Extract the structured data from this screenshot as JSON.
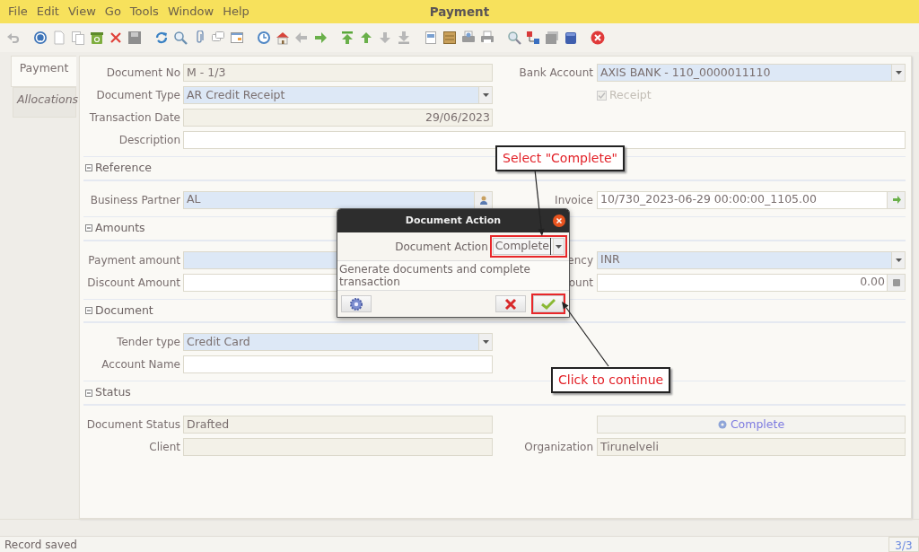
{
  "window": {
    "title": "Payment"
  },
  "menu": [
    {
      "label": "File"
    },
    {
      "label": "Edit"
    },
    {
      "label": "View"
    },
    {
      "label": "Go"
    },
    {
      "label": "Tools"
    },
    {
      "label": "Window"
    },
    {
      "label": "Help"
    }
  ],
  "tabs": [
    {
      "label": "Payment",
      "selected": true
    },
    {
      "label": "Allocations",
      "selected": false
    }
  ],
  "sections": [
    {
      "rows": [
        {
          "left": {
            "label": "Document No",
            "kind": "text",
            "value": "M - 1/3",
            "readonly": true
          },
          "right": {
            "label": "Bank Account",
            "kind": "combo",
            "value": "AXIS BANK - 110_0000011110",
            "readonly": false,
            "mandatory": true
          }
        },
        {
          "left": {
            "label": "Document Type",
            "kind": "combo",
            "value": "AR Credit Receipt",
            "readonly": false,
            "mandatory": true
          },
          "right": {
            "label": "Receipt",
            "kind": "checkbox",
            "checked": true,
            "disabled": true
          }
        },
        {
          "left": {
            "label": "Transaction Date",
            "kind": "date",
            "value": "29/06/2023",
            "readonly": true
          }
        },
        {
          "wide": {
            "label": "Description",
            "kind": "text",
            "readonly": false,
            "mandatory": false
          }
        }
      ]
    },
    {
      "title": "Reference",
      "expanded": true,
      "rows": [
        {
          "left": {
            "label": "Business Partner",
            "kind": "bpartner",
            "value": "AL",
            "readonly": false,
            "mandatory": true
          },
          "right": {
            "label": "Invoice",
            "kind": "lookup",
            "value": "10/730_2023-06-29 00:00:00_1105.00",
            "readonly": false,
            "mandatory": false
          }
        }
      ]
    },
    {
      "title": "Amounts",
      "expanded": true,
      "rows": [
        {
          "left": {
            "label": "Payment amount",
            "kind": "text",
            "readonly": false,
            "mandatory": true
          },
          "right": {
            "label": "ency",
            "kind": "combo",
            "value": "INR",
            "readonly": false,
            "mandatory": true
          }
        },
        {
          "left": {
            "label": "Discount Amount",
            "kind": "text",
            "readonly": false,
            "mandatory": false
          },
          "right": {
            "label": "ount",
            "kind": "number",
            "value": "0.00",
            "readonly": false,
            "mandatory": false
          }
        }
      ]
    },
    {
      "title": "Document",
      "expanded": true,
      "rows": [
        {
          "left": {
            "label": "Tender type",
            "kind": "combo",
            "value": "Credit Card",
            "readonly": false,
            "mandatory": true
          }
        },
        {
          "left": {
            "label": "Account Name",
            "kind": "text",
            "readonly": false,
            "mandatory": false
          }
        }
      ]
    },
    {
      "title": "Status",
      "expanded": true,
      "rows": [
        {
          "left": {
            "label": "Document Status",
            "kind": "text",
            "value": "Drafted",
            "readonly": true
          },
          "right": {
            "kind": "button",
            "value": "Complete"
          }
        },
        {
          "left": {
            "label": "Client",
            "kind": "text",
            "readonly": true
          },
          "right": {
            "label": "Organization",
            "kind": "text",
            "value": "Tirunelveli",
            "readonly": true
          }
        }
      ]
    }
  ],
  "dialog": {
    "title": "Document Action",
    "label": "Document Action",
    "value": "Complete",
    "description": "Generate documents and complete transaction"
  },
  "callouts": [
    {
      "text": "Select \"Complete\""
    },
    {
      "text": "Click to continue"
    }
  ],
  "status_bar": {
    "message": "Record saved",
    "record": "3/3"
  }
}
